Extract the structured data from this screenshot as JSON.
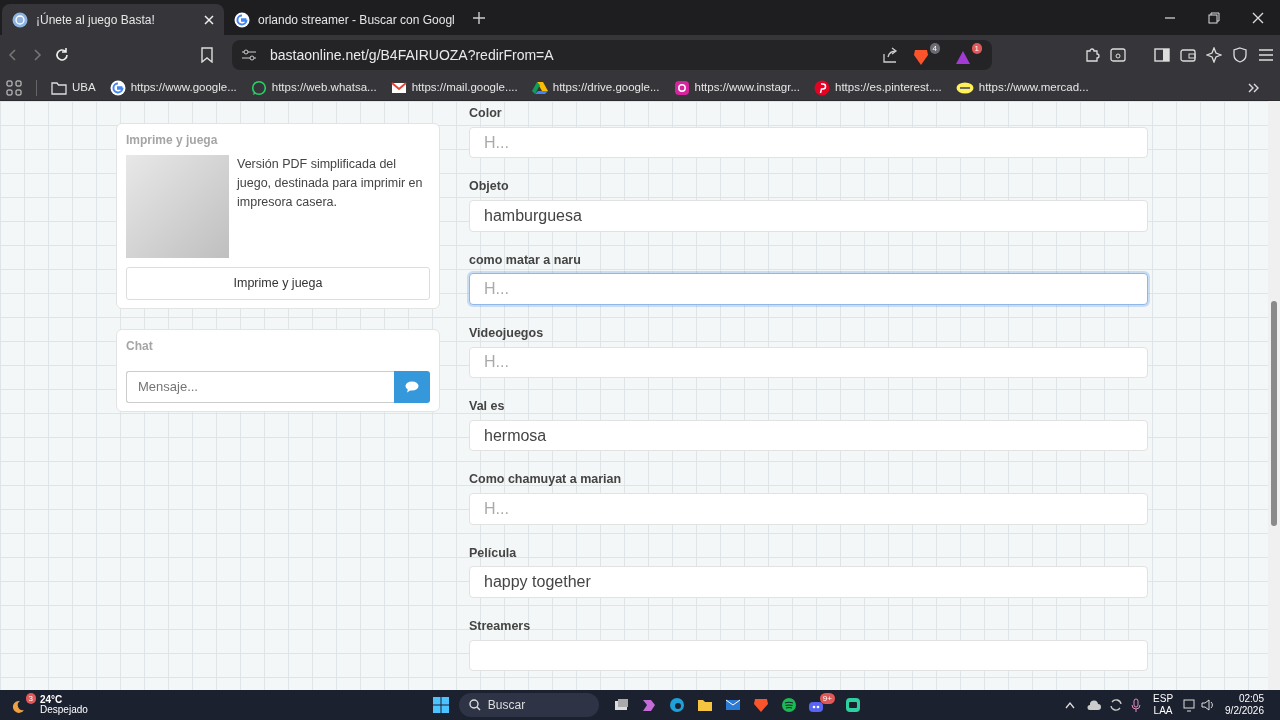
{
  "tabs": [
    {
      "title": "¡Únete al juego Basta!",
      "selected": true
    },
    {
      "title": "orlando streamer - Buscar con Googl",
      "selected": false
    }
  ],
  "address_bar": {
    "url": "bastaonline.net/g/B4FAIRUOZA?redirFrom=A",
    "shields_badge": "4",
    "rewards_badge": "1"
  },
  "bookmarks": [
    {
      "label": "UBA"
    },
    {
      "label": "https://www.google..."
    },
    {
      "label": "https://web.whatsa..."
    },
    {
      "label": "https://mail.google...."
    },
    {
      "label": "https://drive.google..."
    },
    {
      "label": "https://www.instagr..."
    },
    {
      "label": "https://es.pinterest...."
    },
    {
      "label": "https://www.mercad..."
    }
  ],
  "print_card": {
    "title": "Imprime y juega",
    "description": "Versión PDF simplificada del juego, destinada para imprimir en impresora casera.",
    "button": "Imprime y juega"
  },
  "chat_card": {
    "title": "Chat",
    "placeholder": "Mensaje..."
  },
  "fields": [
    {
      "label": "Color",
      "placeholder": "H...",
      "focused": false
    },
    {
      "label": "Objeto",
      "value": "hamburguesa",
      "focused": false
    },
    {
      "label": "como matar a naru",
      "placeholder": "H...",
      "focused": true
    },
    {
      "label": "Videojuegos",
      "placeholder": "H...",
      "focused": false
    },
    {
      "label": "Val es",
      "value": "hermosa",
      "focused": false
    },
    {
      "label": "Como chamuyat a marian",
      "placeholder": "H...",
      "focused": false
    },
    {
      "label": "Película",
      "value": "happy together",
      "focused": false
    },
    {
      "label": "Streamers",
      "focused": false
    }
  ],
  "taskbar": {
    "weather_temp": "24°C",
    "weather_text": "Despejado",
    "weather_badge": "3",
    "search": "Buscar",
    "discord_badge": "9+",
    "language": "ESP",
    "layout": "LAA",
    "time": "02:05",
    "date": "9/2/2026"
  }
}
